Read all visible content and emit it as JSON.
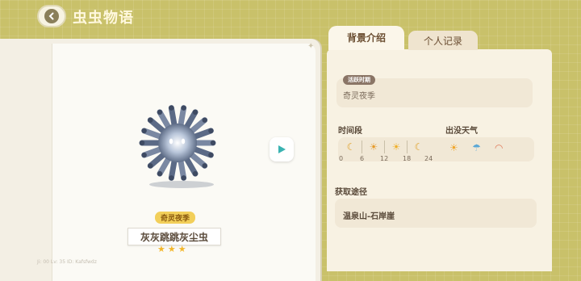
{
  "header": {
    "title": "虫虫物语",
    "back_icon": "chevron-left-icon"
  },
  "creature": {
    "season_badge": "奇灵夜季",
    "name": "灰灰跳跳灰尘虫",
    "rating": 3,
    "stars": [
      "★",
      "★",
      "★"
    ],
    "footer": "Ji: 00   Lv: 35   ID: Kafsfwdz"
  },
  "tabs": [
    {
      "label": "背景介绍",
      "active": true
    },
    {
      "label": "个人记录",
      "active": false
    }
  ],
  "background": {
    "active_label": "活跃时期",
    "active_season": "奇灵夜季",
    "time_title": "时间段",
    "time_slots": [
      {
        "icon": "moon-icon",
        "glyph": "☾"
      },
      {
        "icon": "sunrise-icon",
        "glyph": "☀"
      },
      {
        "icon": "sun-icon",
        "glyph": "☀"
      },
      {
        "icon": "moon-icon",
        "glyph": "☾"
      }
    ],
    "time_ticks": [
      "0",
      "6",
      "12",
      "18",
      "24"
    ],
    "weather_title": "出没天气",
    "weather": [
      {
        "icon": "sun-icon",
        "glyph": "☀"
      },
      {
        "icon": "rain-icon",
        "glyph": "☂"
      },
      {
        "icon": "rainbow-icon",
        "glyph": "◠"
      }
    ],
    "route_title": "获取途径",
    "route": "温泉山-石岸崖"
  },
  "colors": {
    "accent": "#c9c16a",
    "panel": "#f8f2e3",
    "badge": "#f2cf5a",
    "star": "#f3b72c"
  }
}
